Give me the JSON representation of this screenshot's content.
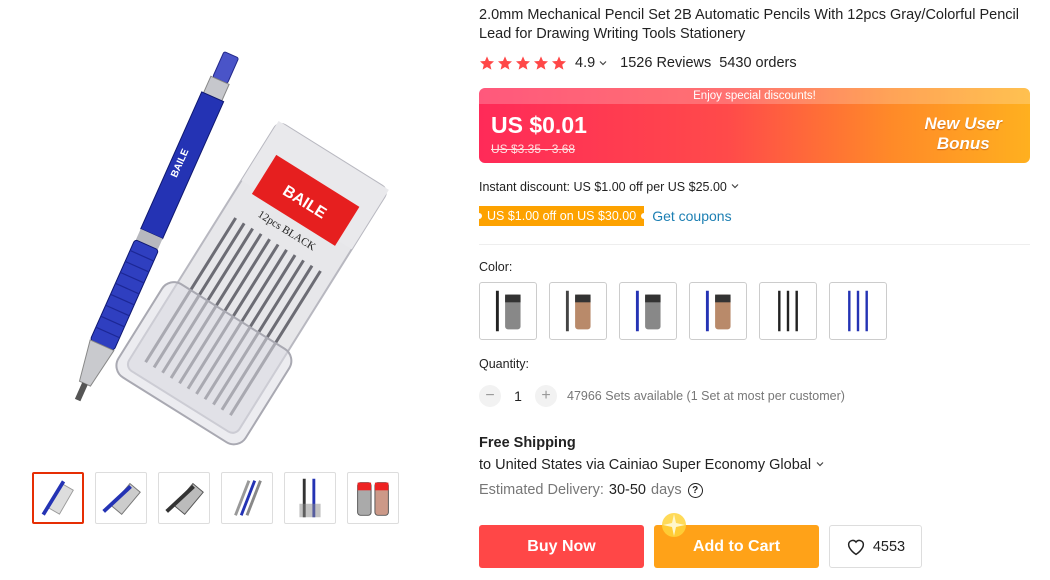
{
  "product": {
    "title": "2.0mm Mechanical Pencil Set 2B Automatic Pencils With 12pcs Gray/Colorful Pencil Lead for Drawing Writing Tools Stationery",
    "rating": "4.9",
    "reviews": "1526 Reviews",
    "orders": "5430 orders",
    "star_color": "#ff4747"
  },
  "gallery": {
    "main_image": "mechanical-pencil-and-lead-case",
    "pencil_label": "BAILE",
    "case_label": "BAILE",
    "case_text": "12pcs BLACK",
    "thumbnails": [
      "pencil-and-case",
      "pencil-and-case-angled",
      "pencil-and-case-dark",
      "multiple-pencils",
      "two-pencils-packaged",
      "two-lead-cases"
    ]
  },
  "promo": {
    "banner_top": "Enjoy special discounts!",
    "price": "US $0.01",
    "original_price": "US $3.35 - 3.68",
    "bonus_line1": "New User",
    "bonus_line2": "Bonus"
  },
  "discounts": {
    "instant": "Instant discount: US $1.00 off per US $25.00",
    "coupon": "US $1.00 off on US $30.00",
    "get_coupons": "Get coupons"
  },
  "color": {
    "label": "Color:",
    "options": [
      "black-pencil-gray-lead",
      "gray-pencil-colorful-lead",
      "blue-pencil-gray-lead",
      "blue-pencil-colorful-lead",
      "three-black-pencils",
      "three-blue-pencils"
    ]
  },
  "quantity": {
    "label": "Quantity:",
    "minus": "−",
    "value": "1",
    "plus": "+",
    "available": "47966 Sets available (1 Set at most per customer)"
  },
  "shipping": {
    "title": "Free Shipping",
    "to": "to United States via Cainiao Super Economy Global",
    "est_label": "Estimated Delivery:",
    "est_value": "30-50",
    "est_unit": "days",
    "help": "?"
  },
  "actions": {
    "buy_now": "Buy Now",
    "add_to_cart": "Add to Cart",
    "wishlist_count": "4553"
  },
  "colors": {
    "price_red": "#ff4747",
    "cart_orange": "#ffa218",
    "coupon_orange": "#fda200",
    "link_blue": "#1c7fb3"
  }
}
